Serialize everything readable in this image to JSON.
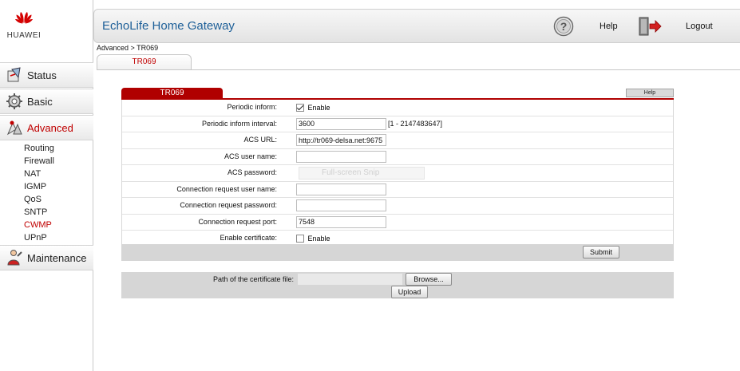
{
  "brand": {
    "logo_text": "HUAWEI",
    "logo_color": "#d40000"
  },
  "header": {
    "title": "EchoLife Home Gateway",
    "help_label": "Help",
    "logout_label": "Logout"
  },
  "sidebar": {
    "main": [
      {
        "label": "Status",
        "icon": "status-icon"
      },
      {
        "label": "Basic",
        "icon": "basic-icon"
      },
      {
        "label": "Advanced",
        "icon": "advanced-icon",
        "active": true
      },
      {
        "label": "Maintenance",
        "icon": "maintenance-icon"
      }
    ],
    "sub": [
      {
        "label": "Routing"
      },
      {
        "label": "Firewall"
      },
      {
        "label": "NAT"
      },
      {
        "label": "IGMP"
      },
      {
        "label": "QoS"
      },
      {
        "label": "SNTP"
      },
      {
        "label": "CWMP",
        "active": true
      },
      {
        "label": "UPnP"
      }
    ]
  },
  "breadcrumb": "Advanced > TR069",
  "page_tab": "TR069",
  "form": {
    "section_title": "TR069",
    "help_button": "Help",
    "fields": {
      "periodic_inform": {
        "label": "Periodic inform:",
        "checked": true,
        "option": "Enable"
      },
      "periodic_inform_interval": {
        "label": "Periodic inform interval:",
        "value": "3600",
        "hint": "[1 - 2147483647]"
      },
      "acs_url": {
        "label": "ACS URL:",
        "value": "http://tr069-delsa.net:9675"
      },
      "acs_user_name": {
        "label": "ACS user name:",
        "value": ""
      },
      "acs_password": {
        "label": "ACS password:",
        "overlay_text": "Full-screen Snip"
      },
      "conn_req_user_name": {
        "label": "Connection request user name:",
        "value": ""
      },
      "conn_req_password": {
        "label": "Connection request password:",
        "value": ""
      },
      "conn_req_port": {
        "label": "Connection request port:",
        "value": "7548"
      },
      "enable_certificate": {
        "label": "Enable certificate:",
        "checked": false,
        "option": "Enable"
      }
    },
    "submit_label": "Submit"
  },
  "certificate": {
    "path_label": "Path of the certificate file:",
    "path_value": "",
    "browse_label": "Browse...",
    "upload_label": "Upload"
  }
}
